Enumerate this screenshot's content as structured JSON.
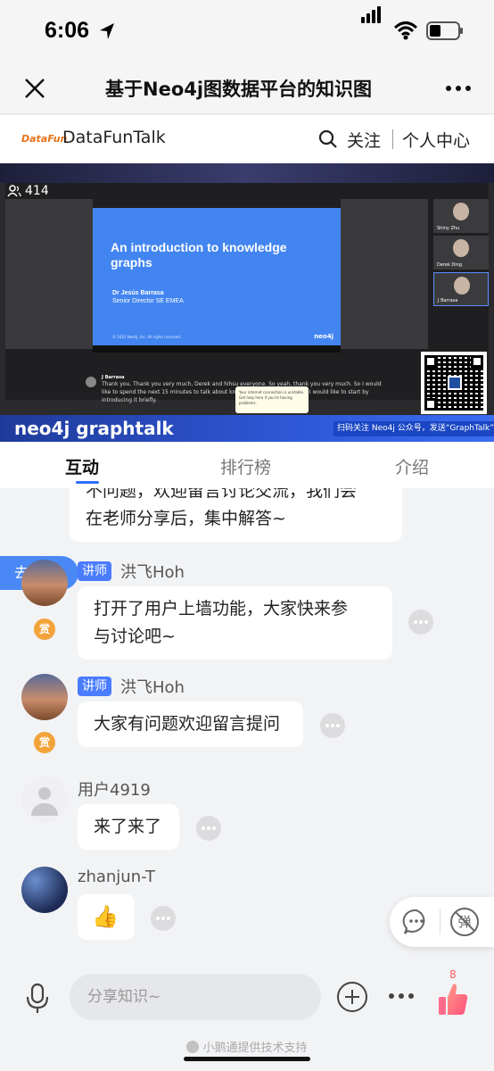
{
  "status_bar": {
    "time": "6:06"
  },
  "navbar": {
    "title": "基于Neo4j图数据平台的知识图"
  },
  "site": {
    "logo_text": "DataFun",
    "name": "DataFunTalk",
    "follow_label": "关注",
    "personal_center_label": "个人中心"
  },
  "video": {
    "viewer_count": "414",
    "slide_title": "An introduction to knowledge graphs",
    "slide_speaker": "Dr Jesús Barrasa",
    "slide_role": "Senior Director SE EMEA",
    "slide_brand": "neo4j",
    "slide_footer": "© 2022 Neo4j, Inc. All rights reserved.",
    "participants": [
      "Shiny Zhu",
      "Derek Ding",
      "J Barrasa"
    ],
    "caption_name": "J Barrasa",
    "caption_text": "Thank you. Thank you very much, Derek and hihsu everyone. So yeah, thank you very much. So I would like to spend the next 15 minutes to talk about knowledge, graphs. And, and I would like to start by introducing it briefly.",
    "tooltip_text": "Your internet connection is unstable. Get help here if you're having problems.",
    "brand_strip": "neo4j graphtalk",
    "banner_text": "扫码关注 Neo4j 公众号，发送“GraphTalk”入群"
  },
  "tabs": [
    {
      "label": "互动",
      "active": true
    },
    {
      "label": "排行榜",
      "active": false
    },
    {
      "label": "介绍",
      "active": false
    }
  ],
  "chat": {
    "join_mic_label": "去连麦",
    "lecturer_badge": "讲师",
    "reward_label": "赏",
    "messages": [
      {
        "user": "",
        "text": "不问题，欢迎留言讨论交流，我们会\n在老师分享后，集中解答~"
      },
      {
        "user": "洪飞Hoh",
        "role": "讲师",
        "text": "打开了用户上墙功能，大家快来参\n与讨论吧~"
      },
      {
        "user": "洪飞Hoh",
        "role": "讲师",
        "text": "大家有问题欢迎留言提问"
      },
      {
        "user": "用户4919",
        "text": "来了来了"
      },
      {
        "user": "zhanjun-T",
        "text": "👍"
      }
    ],
    "barrage_label": "弹"
  },
  "bottom_bar": {
    "input_placeholder": "分享知识~",
    "like_count": "8",
    "powered_by": "小鹅通提供技术支持"
  }
}
